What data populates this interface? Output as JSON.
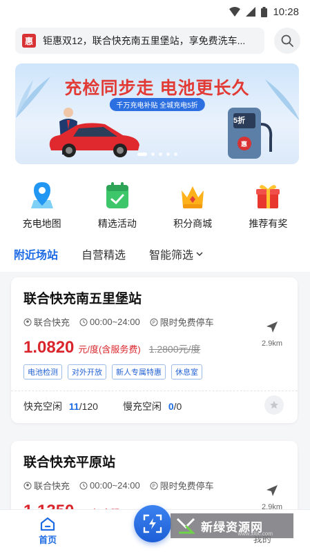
{
  "status": {
    "time": "10:28"
  },
  "notice": {
    "badge": "惠",
    "text": "钜惠双12，联合快充南五里堡站，享免费洗车..."
  },
  "banner": {
    "title": "充检同步走  电池更长久",
    "subtitle": "千万充电补贴  全城充电5折",
    "pump_label": "5折",
    "pump_badge": "惠"
  },
  "quick_actions": [
    {
      "label": "充电地图",
      "icon": "map-pin-icon"
    },
    {
      "label": "精选活动",
      "icon": "calendar-check-icon"
    },
    {
      "label": "积分商城",
      "icon": "crown-icon"
    },
    {
      "label": "推荐有奖",
      "icon": "gift-icon"
    }
  ],
  "tabs": {
    "nearby": "附近场站",
    "self_run": "自营精选",
    "filter": "智能筛选"
  },
  "stations": [
    {
      "name": "联合快充南五里堡站",
      "operator": "联合快充",
      "hours": "00:00~24:00",
      "parking": "限时免费停车",
      "price": "1.0820",
      "price_unit": "元/度(含服务费)",
      "price_old": "1.2800元/度",
      "distance": "2.9km",
      "tags": [
        "电池检测",
        "对外开放",
        "新人专属特惠",
        "休息室"
      ],
      "fast_label": "快充空闲",
      "fast_free": "11",
      "fast_total": "/120",
      "slow_label": "慢充空闲",
      "slow_free": "0",
      "slow_total": "/0"
    },
    {
      "name": "联合快充平原站",
      "operator": "联合快充",
      "hours": "00:00~24:00",
      "parking": "限时免费停车",
      "price": "1.1350",
      "price_unit": "元/度(含服",
      "distance": "2.9km"
    }
  ],
  "tabbar": {
    "home": "首页",
    "mine": "我的"
  },
  "watermark": {
    "text": "新绿资源网",
    "url": "www.xlbc.com"
  },
  "colors": {
    "primary": "#1d6ae5",
    "price": "#d9252b"
  }
}
